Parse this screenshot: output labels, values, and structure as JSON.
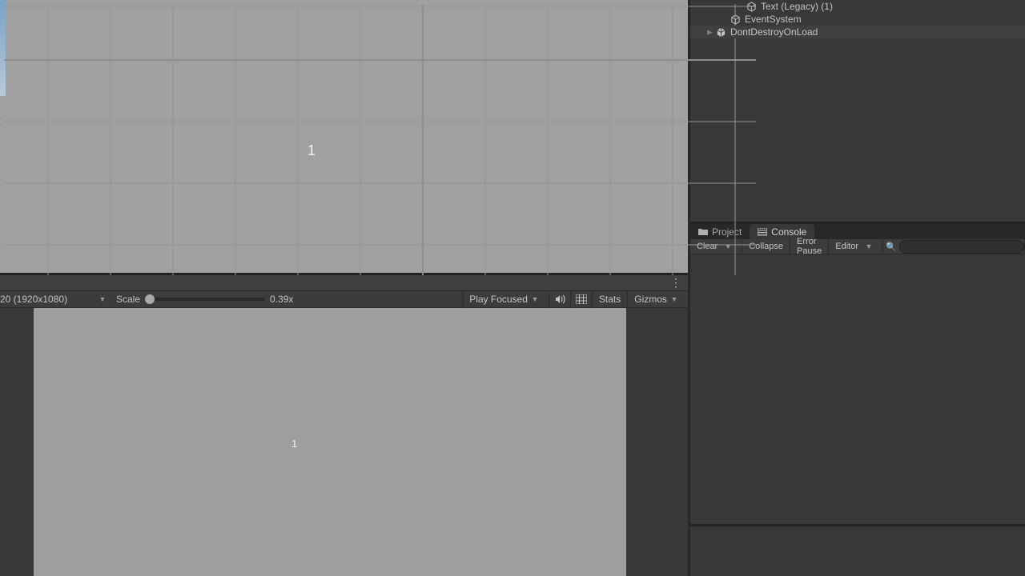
{
  "hierarchy": {
    "items": [
      {
        "label": "Text (Legacy) (1)",
        "icon": "cube-outline",
        "depth": 3
      },
      {
        "label": "EventSystem",
        "icon": "cube-outline",
        "depth": 2
      },
      {
        "label": "DontDestroyOnLoad",
        "icon": "unity-cube",
        "depth": 1,
        "expandable": true,
        "highlighted": true
      }
    ]
  },
  "scene_view": {
    "overlay_number": "1"
  },
  "game_toolbar": {
    "resolution_label": "20 (1920x1080)",
    "scale_label": "Scale",
    "scale_value": "0.39x",
    "play_mode_label": "Play Focused",
    "stats_label": "Stats",
    "gizmos_label": "Gizmos"
  },
  "game_view": {
    "overlay_number": "1"
  },
  "panel_tabs": {
    "project": "Project",
    "console": "Console",
    "active": "console"
  },
  "console_toolbar": {
    "clear": "Clear",
    "collapse": "Collapse",
    "error_pause": "Error Pause",
    "editor": "Editor",
    "search_placeholder": ""
  },
  "colors": {
    "panel_bg": "#383838",
    "toolbar_bg": "#3c3c3c",
    "canvas_grey": "#9e9e9e",
    "text": "#c4c4c4"
  }
}
